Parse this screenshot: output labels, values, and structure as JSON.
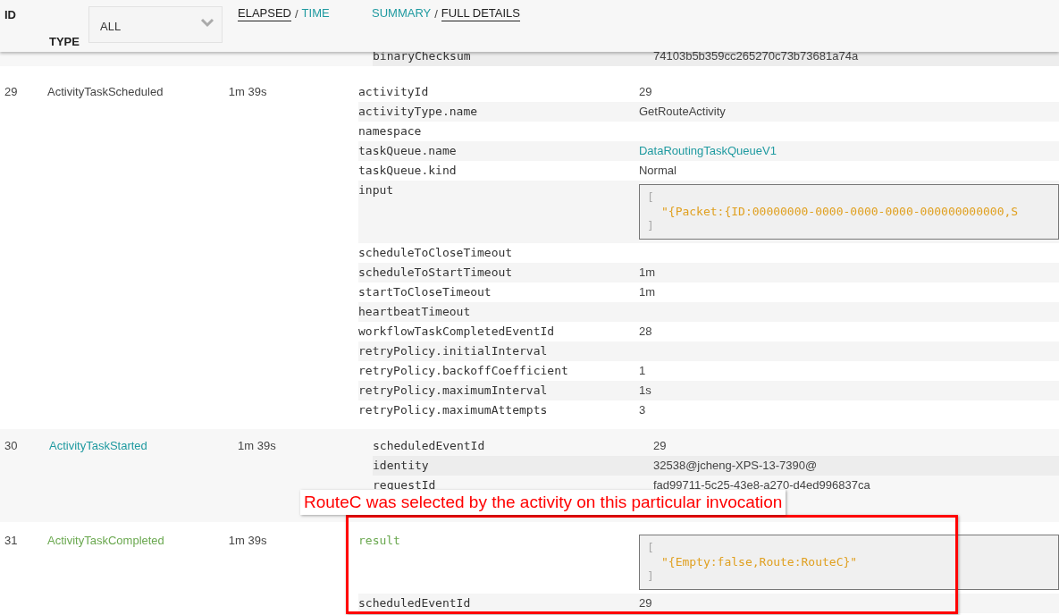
{
  "header": {
    "id_label": "ID",
    "type_label": "TYPE",
    "type_filter": {
      "value": "ALL"
    },
    "time_toggle": {
      "separator": "/",
      "options": [
        {
          "label": "ELAPSED",
          "selected": true
        },
        {
          "label": "TIME",
          "selected": false
        }
      ]
    },
    "detail_toggle": {
      "separator": "/",
      "options": [
        {
          "label": "SUMMARY",
          "selected": false
        },
        {
          "label": "FULL DETAILS",
          "selected": true
        }
      ]
    }
  },
  "events": [
    {
      "partial": true,
      "details": [
        {
          "key": "binaryChecksum",
          "value": "74103b5b359cc265270c73b73681a74a",
          "kind": "text"
        }
      ]
    },
    {
      "id": "29",
      "type": "ActivityTaskScheduled",
      "elapsed": "1m 39s",
      "kind": "scheduled",
      "partial": false,
      "details": [
        {
          "key": "activityId",
          "value": "29",
          "kind": "text"
        },
        {
          "key": "activityType.name",
          "value": "GetRouteActivity",
          "kind": "text"
        },
        {
          "key": "namespace",
          "kind": "text"
        },
        {
          "key": "taskQueue.name",
          "value": "DataRoutingTaskQueueV1",
          "kind": "link"
        },
        {
          "key": "taskQueue.kind",
          "value": "Normal",
          "kind": "text"
        },
        {
          "key": "input",
          "value": "\"{Packet:{ID:00000000-0000-0000-0000-000000000000,S",
          "kind": "json",
          "open": "[",
          "close": "]"
        },
        {
          "key": "scheduleToCloseTimeout",
          "kind": "text"
        },
        {
          "key": "scheduleToStartTimeout",
          "value": "1m",
          "kind": "text"
        },
        {
          "key": "startToCloseTimeout",
          "value": "1m",
          "kind": "text"
        },
        {
          "key": "heartbeatTimeout",
          "kind": "text"
        },
        {
          "key": "workflowTaskCompletedEventId",
          "value": "28",
          "kind": "text"
        },
        {
          "key": "retryPolicy.initialInterval",
          "kind": "text"
        },
        {
          "key": "retryPolicy.backoffCoefficient",
          "value": "1",
          "kind": "text"
        },
        {
          "key": "retryPolicy.maximumInterval",
          "value": "1s",
          "kind": "text"
        },
        {
          "key": "retryPolicy.maximumAttempts",
          "value": "3",
          "kind": "text"
        }
      ]
    },
    {
      "id": "30",
      "type": "ActivityTaskStarted",
      "elapsed": "1m 39s",
      "kind": "started",
      "partial": false,
      "details": [
        {
          "key": "scheduledEventId",
          "value": "29",
          "kind": "text"
        },
        {
          "key": "identity",
          "value": "32538@jcheng-XPS-13-7390@",
          "kind": "text"
        },
        {
          "key": "requestId",
          "value": "fad99711-5c25-43e8-a270-d4ed996837ca",
          "kind": "text"
        }
      ]
    },
    {
      "id": "31",
      "type": "ActivityTaskCompleted",
      "elapsed": "1m 39s",
      "kind": "completed",
      "partial": false,
      "annotation": "RouteC was selected by the activity on this particular invocation",
      "details": [
        {
          "key": "result",
          "value": "\"{Empty:false,Route:RouteC}\"",
          "kind": "result",
          "open": "[",
          "close": "]"
        },
        {
          "key": "scheduledEventId",
          "value": "29",
          "kind": "text"
        }
      ]
    }
  ]
}
